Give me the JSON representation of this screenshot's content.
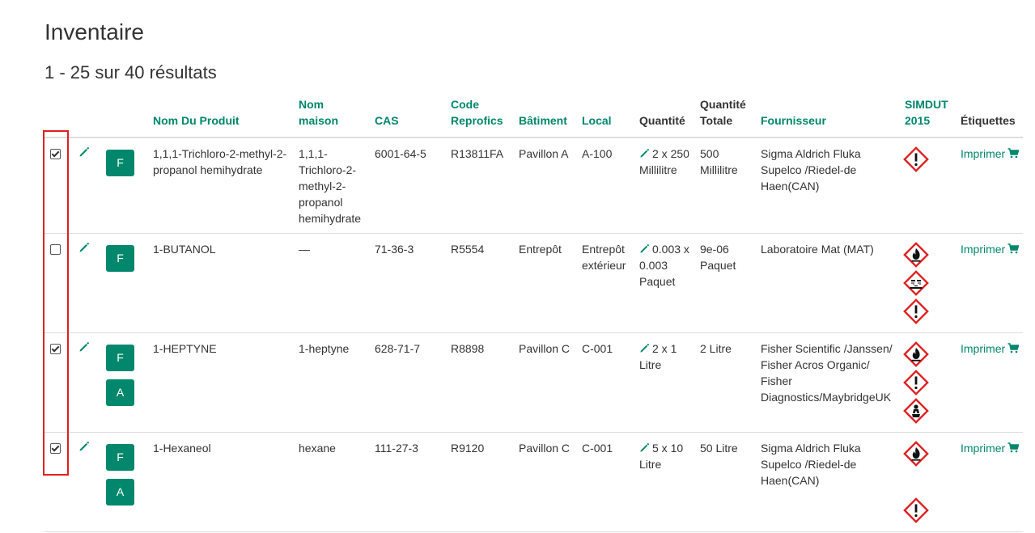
{
  "page": {
    "title": "Inventaire",
    "results_summary": "1 - 25 sur 40 résultats"
  },
  "table": {
    "headers": {
      "product_name": "Nom Du Produit",
      "house_name": "Nom maison",
      "cas": "CAS",
      "code": "Code Reprofics",
      "building": "Bâtiment",
      "room": "Local",
      "quantity": "Quantité",
      "total_quantity": "Quantité Totale",
      "supplier": "Fournisseur",
      "simdut": "SIMDUT 2015",
      "labels": "Étiquettes"
    },
    "rows": [
      {
        "checked": true,
        "tags": [
          "F"
        ],
        "product_name": "1,1,1-Trichloro-2-methyl-2-propanol hemihydrate",
        "house_name": "1,1,1-Trichloro-2-methyl-2-propanol hemihydrate",
        "cas": "6001-64-5",
        "code": "R13811FA",
        "building": "Pavillon A",
        "room": "A-100",
        "quantity": "2 x 250 Millilitre",
        "total_quantity": "500 Millilitre",
        "supplier": "Sigma Aldrich Fluka Supelco /Riedel-de Haen(CAN)",
        "hazards": [
          "exclamation-mark"
        ],
        "print_label": "Imprimer"
      },
      {
        "checked": false,
        "tags": [
          "F"
        ],
        "product_name": "1-BUTANOL",
        "house_name": "—",
        "cas": "71-36-3",
        "code": "R5554",
        "building": "Entrepôt",
        "room": "Entrepôt extérieur",
        "quantity": "0.003 x 0.003 Paquet",
        "total_quantity": "9e-06 Paquet",
        "supplier": "Laboratoire Mat (MAT)",
        "hazards": [
          "flame",
          "corrosion",
          "exclamation-mark"
        ],
        "print_label": "Imprimer"
      },
      {
        "checked": true,
        "tags": [
          "F",
          "A"
        ],
        "product_name": "1-HEPTYNE",
        "house_name": "1-heptyne",
        "cas": "628-71-7",
        "code": "R8898",
        "building": "Pavillon C",
        "room": "C-001",
        "quantity": "2 x 1 Litre",
        "total_quantity": "2 Litre",
        "supplier": "Fisher Scientific /Janssen/ Fisher Acros Organic/ Fisher Diagnostics/MaybridgeUK",
        "hazards": [
          "flame",
          "exclamation-mark",
          "health-hazard"
        ],
        "print_label": "Imprimer"
      },
      {
        "checked": true,
        "tags": [
          "F",
          "A"
        ],
        "product_name": "1-Hexaneol",
        "house_name": "hexane",
        "cas": "111-27-3",
        "code": "R9120",
        "building": "Pavillon C",
        "room": "C-001",
        "quantity": "5 x 10 Litre",
        "total_quantity": "50 Litre",
        "supplier": "Sigma Aldrich Fluka Supelco /Riedel-de Haen(CAN)",
        "hazards": [
          "flame",
          "exclamation-mark"
        ],
        "print_label": "Imprimer"
      }
    ]
  },
  "colors": {
    "accent": "#00876c",
    "hazard_red": "#e02020",
    "highlight_box": "#e02020"
  }
}
